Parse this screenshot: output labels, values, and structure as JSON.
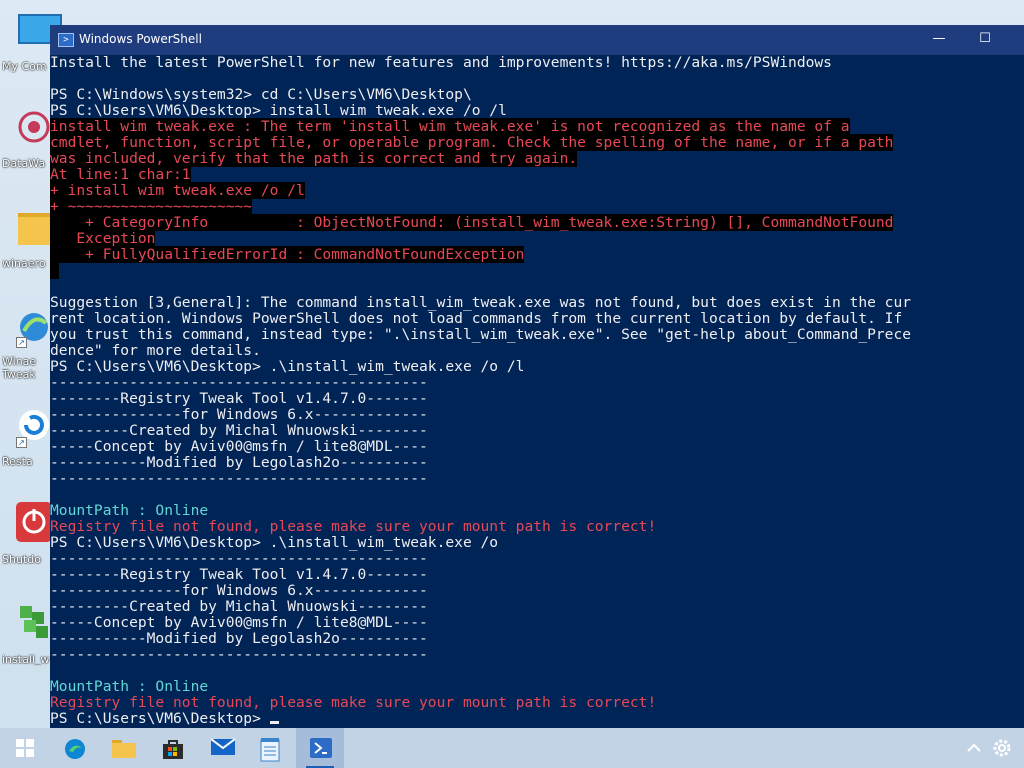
{
  "desktop": {
    "icons": [
      {
        "label": "My Com"
      },
      {
        "label": "DataWa"
      },
      {
        "label": "winaero"
      },
      {
        "label": "Winae\nTweak"
      },
      {
        "label": "Resta"
      },
      {
        "label": "Shutdo"
      },
      {
        "label": "install_w"
      }
    ]
  },
  "window": {
    "title": "Windows PowerShell",
    "lines": [
      {
        "text": "Install the latest PowerShell for new features and improvements! https://aka.ms/PSWindows",
        "style": "normal"
      },
      {
        "text": "",
        "style": "normal"
      },
      {
        "text": "PS C:\\Windows\\system32> cd C:\\Users\\VM6\\Desktop\\",
        "style": "normal"
      },
      {
        "text": "PS C:\\Users\\VM6\\Desktop> install_wim_tweak.exe /o /l",
        "style": "normal"
      },
      {
        "text": "install_wim_tweak.exe : The term 'install_wim_tweak.exe' is not recognized as the name of a",
        "style": "err"
      },
      {
        "text": "cmdlet, function, script file, or operable program. Check the spelling of the name, or if a path",
        "style": "err"
      },
      {
        "text": "was included, verify that the path is correct and try again.",
        "style": "err"
      },
      {
        "text": "At line:1 char:1",
        "style": "err"
      },
      {
        "text": "+ install_wim_tweak.exe /o /l",
        "style": "err"
      },
      {
        "text": "+ ~~~~~~~~~~~~~~~~~~~~~",
        "style": "err"
      },
      {
        "text": "    + CategoryInfo          : ObjectNotFound: (install_wim_tweak.exe:String) [], CommandNotFound",
        "style": "err"
      },
      {
        "text": "   Exception",
        "style": "err"
      },
      {
        "text": "    + FullyQualifiedErrorId : CommandNotFoundException",
        "style": "err"
      },
      {
        "text": " ",
        "style": "err"
      },
      {
        "text": "",
        "style": "normal"
      },
      {
        "text": "Suggestion [3,General]: The command install_wim_tweak.exe was not found, but does exist in the cur",
        "style": "normal"
      },
      {
        "text": "rent location. Windows PowerShell does not load commands from the current location by default. If",
        "style": "normal"
      },
      {
        "text": "you trust this command, instead type: \".\\install_wim_tweak.exe\". See \"get-help about_Command_Prece",
        "style": "normal"
      },
      {
        "text": "dence\" for more details.",
        "style": "normal"
      },
      {
        "text": "PS C:\\Users\\VM6\\Desktop> .\\install_wim_tweak.exe /o /l",
        "style": "normal"
      },
      {
        "text": "-------------------------------------------",
        "style": "normal"
      },
      {
        "text": "--------Registry Tweak Tool v1.4.7.0-------",
        "style": "normal"
      },
      {
        "text": "---------------for Windows 6.x-------------",
        "style": "normal"
      },
      {
        "text": "---------Created by Michal Wnuowski--------",
        "style": "normal"
      },
      {
        "text": "-----Concept by Aviv00@msfn / lite8@MDL----",
        "style": "normal"
      },
      {
        "text": "-----------Modified by Legolash2o----------",
        "style": "normal"
      },
      {
        "text": "-------------------------------------------",
        "style": "normal"
      },
      {
        "text": "",
        "style": "normal"
      },
      {
        "text": "MountPath : Online",
        "style": "cyan"
      },
      {
        "text": "Registry file not found, please make sure your mount path is correct!",
        "style": "errplain"
      },
      {
        "text": "PS C:\\Users\\VM6\\Desktop> .\\install_wim_tweak.exe /o",
        "style": "normal"
      },
      {
        "text": "-------------------------------------------",
        "style": "normal"
      },
      {
        "text": "--------Registry Tweak Tool v1.4.7.0-------",
        "style": "normal"
      },
      {
        "text": "---------------for Windows 6.x-------------",
        "style": "normal"
      },
      {
        "text": "---------Created by Michal Wnuowski--------",
        "style": "normal"
      },
      {
        "text": "-----Concept by Aviv00@msfn / lite8@MDL----",
        "style": "normal"
      },
      {
        "text": "-----------Modified by Legolash2o----------",
        "style": "normal"
      },
      {
        "text": "-------------------------------------------",
        "style": "normal"
      },
      {
        "text": "",
        "style": "normal"
      },
      {
        "text": "MountPath : Online",
        "style": "cyan"
      },
      {
        "text": "Registry file not found, please make sure your mount path is correct!",
        "style": "errplain"
      },
      {
        "text": "PS C:\\Users\\VM6\\Desktop> ",
        "style": "prompt"
      }
    ]
  },
  "taskbar": {
    "icons": [
      "windows-start-icon",
      "edge-icon",
      "file-explorer-icon",
      "store-icon",
      "mail-icon",
      "notepad-icon",
      "powershell-icon"
    ],
    "active": "powershell-icon"
  },
  "colors": {
    "console_bg": "#012456",
    "console_fg": "#eeedf0",
    "error_fg": "#e74856",
    "cyan_fg": "#61d6d6",
    "titlebar": "#1f3c7f"
  }
}
